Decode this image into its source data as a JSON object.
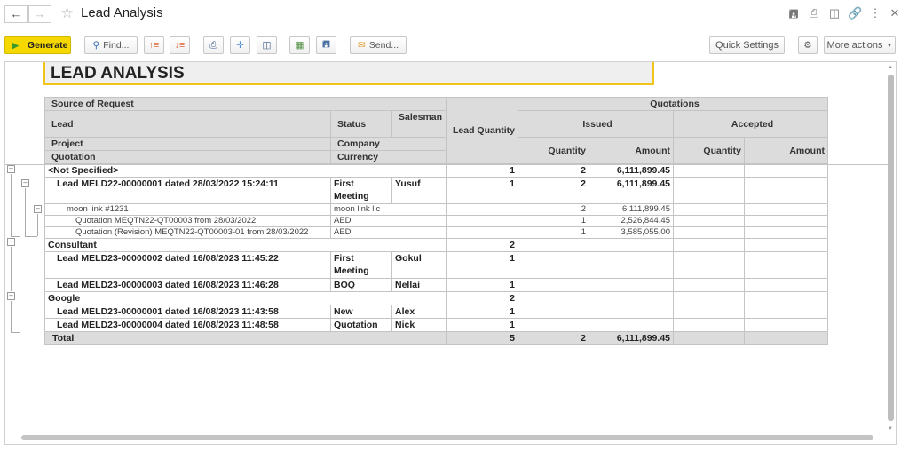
{
  "window": {
    "title": "Lead Analysis",
    "icons": [
      "save-icon",
      "print-icon",
      "preview-icon",
      "link-icon",
      "kebab-icon",
      "close-icon"
    ]
  },
  "toolbar": {
    "generate": "Generate",
    "find": "Find...",
    "send": "Send...",
    "quick_settings": "Quick Settings",
    "more_actions": "More actions"
  },
  "report": {
    "title": "LEAD ANALYSIS"
  },
  "headers": {
    "source": "Source of Request",
    "lead": "Lead",
    "status": "Status",
    "salesman": "Salesman",
    "project": "Project",
    "company": "Company",
    "quotation": "Quotation",
    "currency": "Currency",
    "lead_qty": "Lead Quantity",
    "quotations": "Quotations",
    "issued": "Issued",
    "accepted": "Accepted",
    "quantity": "Quantity",
    "amount": "Amount"
  },
  "rows": [
    {
      "type": "group",
      "text": "<Not Specified>",
      "lead_qty": "1",
      "iss_qty": "2",
      "iss_amt": "6,111,899.45"
    },
    {
      "type": "lead",
      "text": "Lead MELD22-00000001 dated 28/03/2022 15:24:11",
      "status": "First Meeting",
      "salesman": "Yusuf",
      "lead_qty": "1",
      "iss_qty": "2",
      "iss_amt": "6,111,899.45"
    },
    {
      "type": "project",
      "text": "moon link #1231",
      "company": "moon link llc",
      "iss_qty": "2",
      "iss_amt": "6,111,899.45"
    },
    {
      "type": "quote",
      "text": "Quotation MEQTN22-QT00003 from 28/03/2022",
      "company": "AED",
      "iss_qty": "1",
      "iss_amt": "2,526,844.45"
    },
    {
      "type": "quote",
      "text": "Quotation (Revision) MEQTN22-QT00003-01 from 28/03/2022",
      "company": "AED",
      "iss_qty": "1",
      "iss_amt": "3,585,055.00"
    },
    {
      "type": "group",
      "text": "Consultant",
      "lead_qty": "2"
    },
    {
      "type": "lead",
      "text": "Lead MELD23-00000002 dated 16/08/2023 11:45:22",
      "status": "First Meeting",
      "salesman": "Gokul",
      "lead_qty": "1"
    },
    {
      "type": "lead",
      "text": "Lead MELD23-00000003 dated 16/08/2023 11:46:28",
      "status": "BOQ",
      "salesman": "Nellai",
      "lead_qty": "1"
    },
    {
      "type": "group",
      "text": "Google",
      "lead_qty": "2"
    },
    {
      "type": "lead",
      "text": "Lead MELD23-00000001 dated 16/08/2023 11:43:58",
      "status": "New",
      "salesman": "Alex",
      "lead_qty": "1"
    },
    {
      "type": "lead",
      "text": "Lead MELD23-00000004 dated 16/08/2023 11:48:58",
      "status": "Quotation",
      "salesman": "Nick",
      "lead_qty": "1"
    },
    {
      "type": "total",
      "text": "Total",
      "lead_qty": "5",
      "iss_qty": "2",
      "iss_amt": "6,111,899.45"
    }
  ]
}
